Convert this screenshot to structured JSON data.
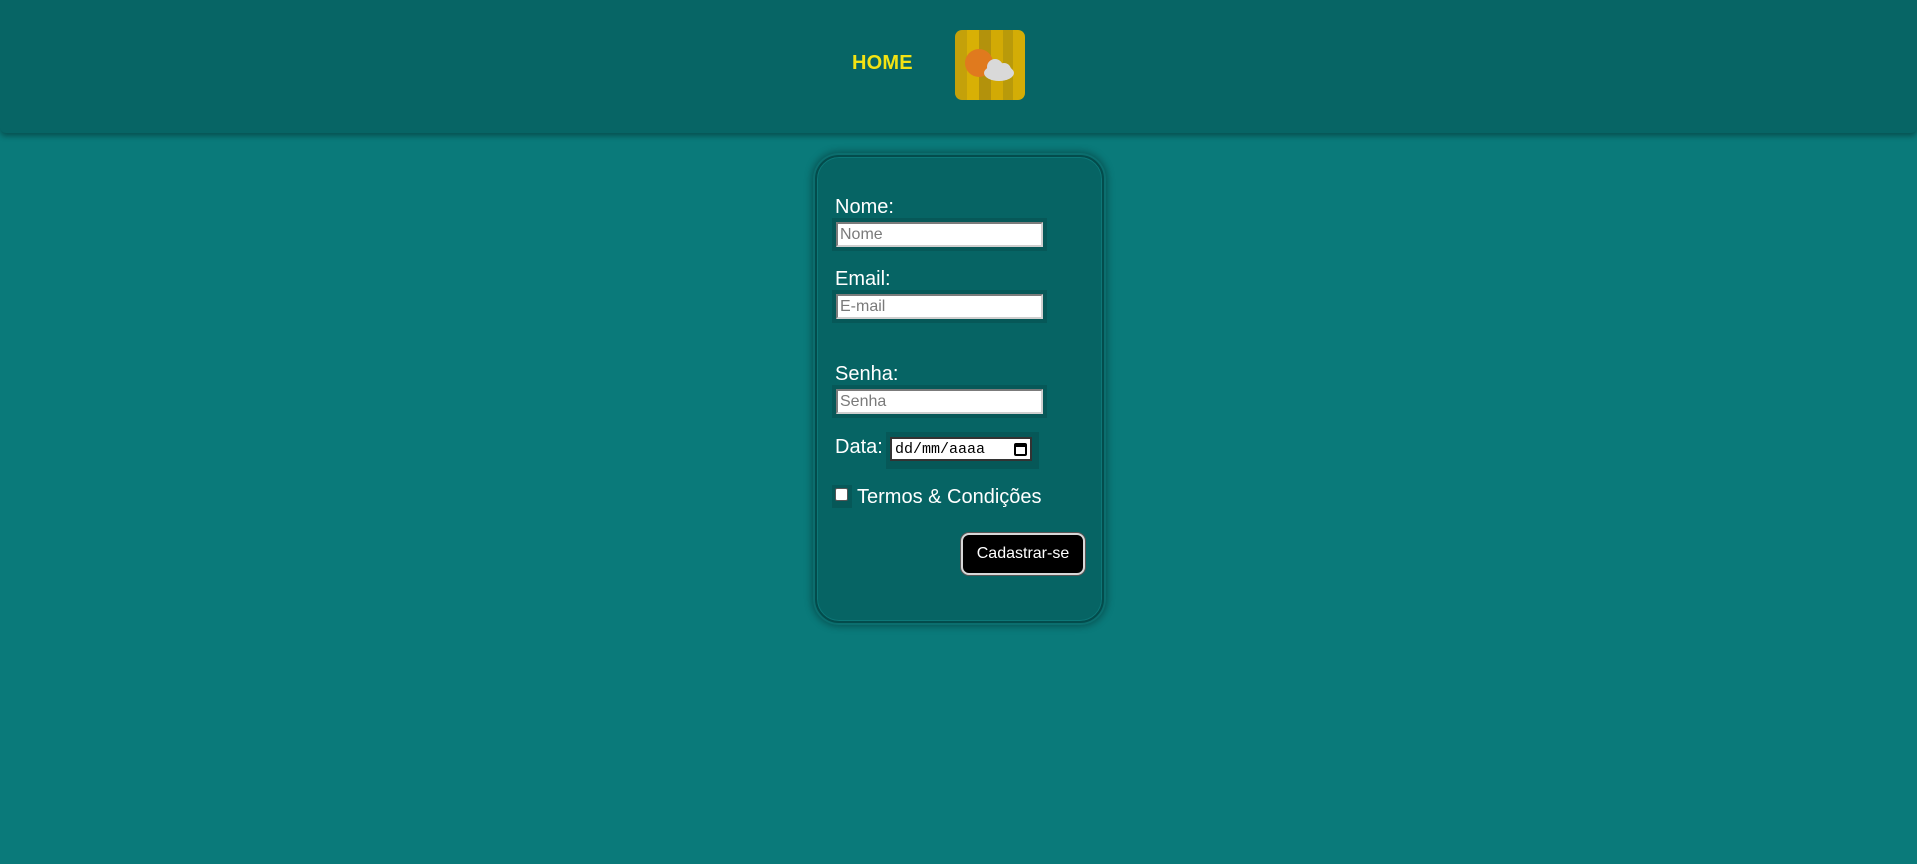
{
  "nav": {
    "home_label": "HOME",
    "logo_icon": "weather-sun-cloud-icon"
  },
  "form": {
    "name_label": "Nome:",
    "name_placeholder": "Nome",
    "email_label": "Email:",
    "email_placeholder": "E-mail",
    "password_label": "Senha:",
    "password_placeholder": "Senha",
    "date_label": "Data:",
    "date_placeholder": "dd/mm/aaaa",
    "terms_label": "Termos & Condições",
    "terms_checked": false,
    "submit_label": "Cadastrar-se"
  },
  "colors": {
    "background": "#0a7a7a",
    "header": "#076565",
    "card": "#066464",
    "home_link": "#f2e313",
    "button": "#000000"
  }
}
